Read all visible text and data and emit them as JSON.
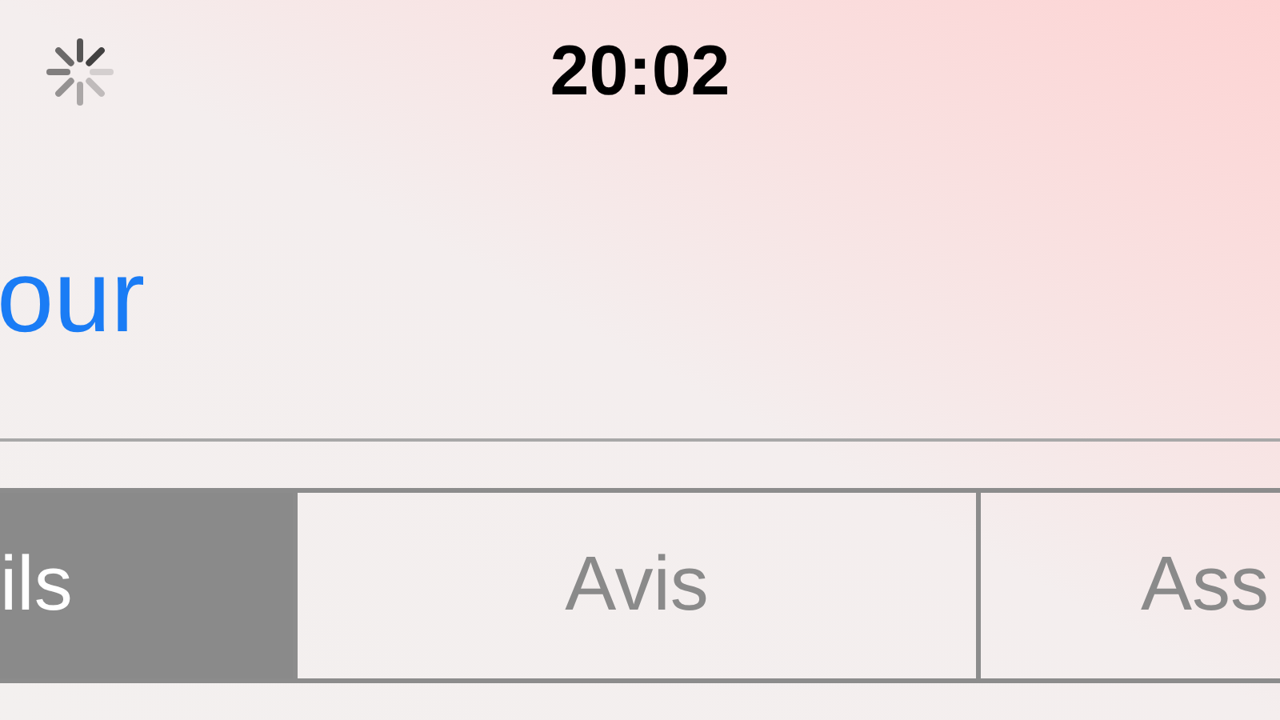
{
  "status_bar": {
    "loading": true,
    "time": "20:02"
  },
  "nav_link": {
    "label": "our"
  },
  "segments": [
    {
      "label": "ils",
      "selected": true
    },
    {
      "label": "Avis",
      "selected": false
    },
    {
      "label": "Ass",
      "selected": false
    }
  ]
}
